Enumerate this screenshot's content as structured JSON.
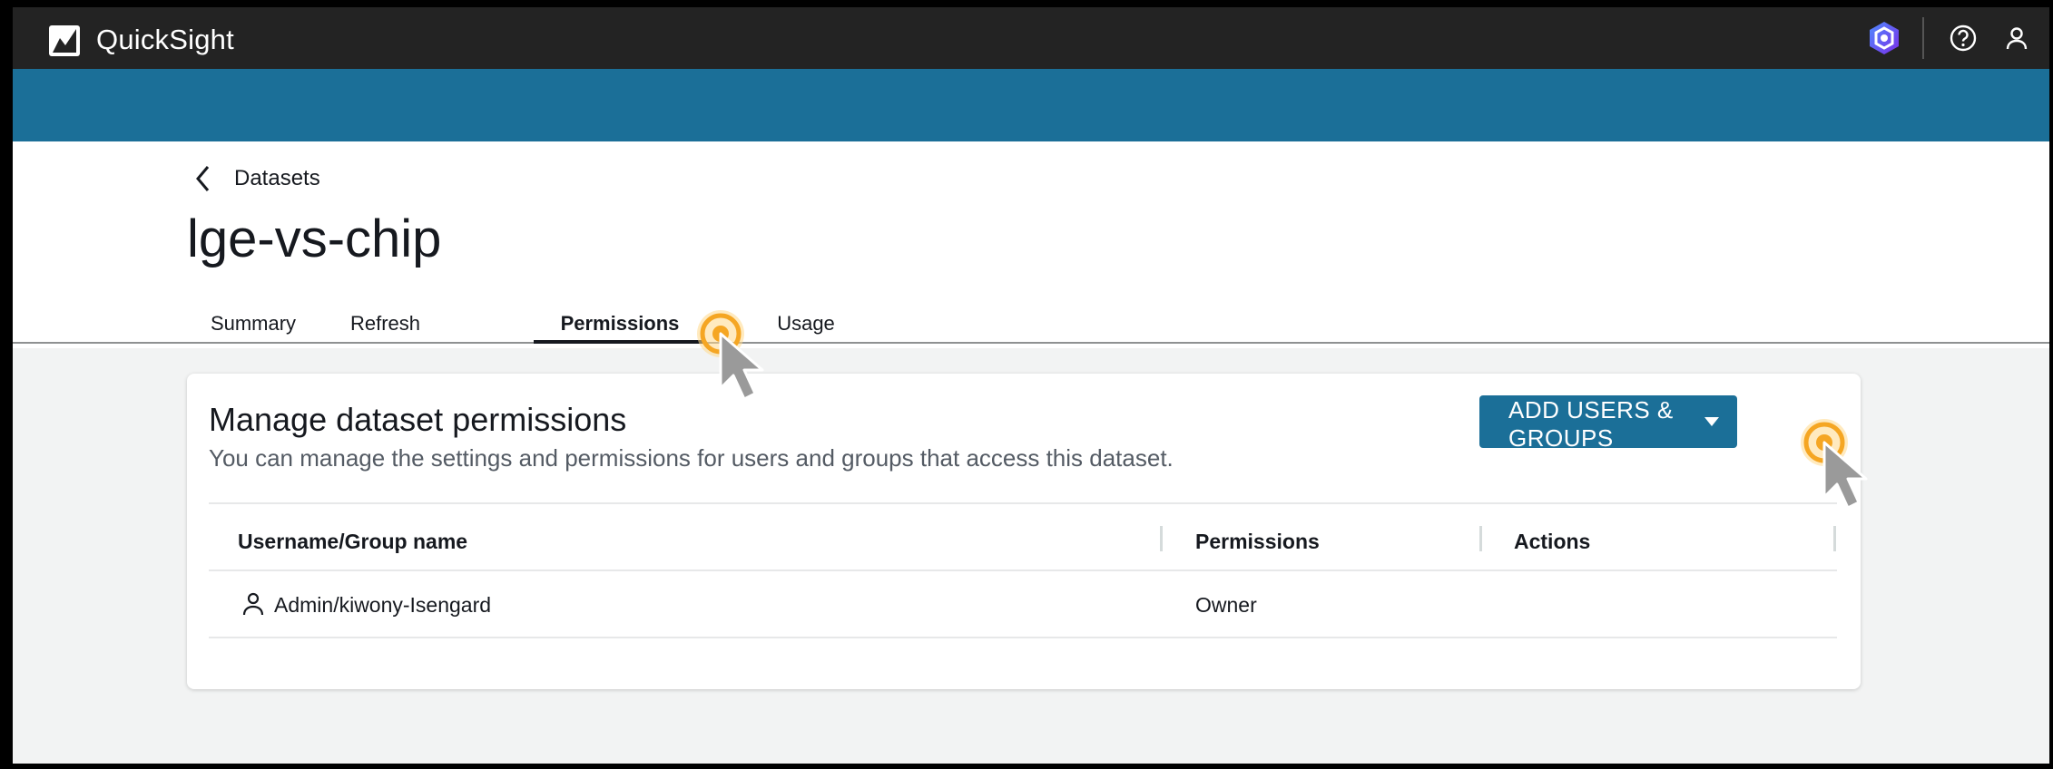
{
  "app": {
    "name": "QuickSight"
  },
  "breadcrumb": {
    "label": "Datasets"
  },
  "page": {
    "title": "lge-vs-chip"
  },
  "tabs": [
    {
      "label": "Summary",
      "active": false
    },
    {
      "label": "Refresh",
      "active": false
    },
    {
      "label": "Permissions",
      "active": true
    },
    {
      "label": "Usage",
      "active": false
    }
  ],
  "permissions_card": {
    "title": "Manage dataset permissions",
    "description": "You can manage the settings and permissions for users and groups that access this dataset.",
    "add_button_label": "ADD USERS & GROUPS",
    "columns": [
      "Username/Group name",
      "Permissions",
      "Actions"
    ],
    "rows": [
      {
        "name": "Admin/kiwony-Isengard",
        "permission": "Owner",
        "icon": "person-icon"
      }
    ]
  },
  "icons": {
    "logo": "quicksight-logo-icon",
    "header_right": [
      "hexagon-app-icon",
      "help-icon",
      "user-icon"
    ],
    "breadcrumb": "chevron-left-icon",
    "cursors": [
      "click-cursor-icon",
      "click-cursor-icon"
    ]
  },
  "colors": {
    "topbar": "#232323",
    "accent_blue": "#1b6f98",
    "click_ring": "#f5a623"
  }
}
